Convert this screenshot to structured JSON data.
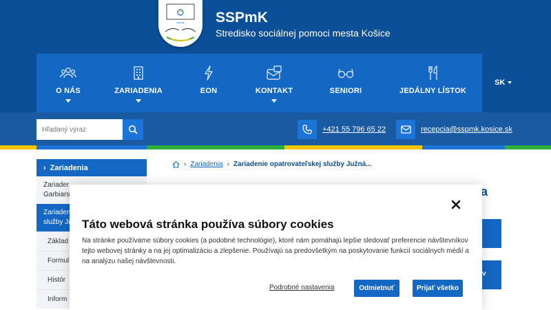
{
  "header": {
    "site_title": "SSPmK",
    "site_subtitle": "Stredisko sociálnej pomoci mesta Košice",
    "logo_alt": "Logo SSPmK"
  },
  "nav": {
    "items": [
      {
        "label": "O NÁS",
        "icon": "people-icon",
        "has_dropdown": true
      },
      {
        "label": "ZARIADENIA",
        "icon": "building-icon",
        "has_dropdown": true
      },
      {
        "label": "EON",
        "icon": "bolt-icon",
        "has_dropdown": false
      },
      {
        "label": "KONTAKT",
        "icon": "contact-card-icon",
        "has_dropdown": true
      },
      {
        "label": "SENIORI",
        "icon": "glasses-icon",
        "has_dropdown": false
      },
      {
        "label": "JEDÁLNY LÍSTOK",
        "icon": "cutlery-icon",
        "has_dropdown": false
      }
    ],
    "language": "SK"
  },
  "search": {
    "placeholder": "Hľadaný výraz"
  },
  "contacts": {
    "phone": "+421 55 796 65 22",
    "email": "recepcia@sspmk.kosice.sk"
  },
  "sidebar": {
    "heading": "Zariadenia",
    "items": [
      "Zariader",
      "Garbiars",
      "Zariaden",
      "služby Ju"
    ],
    "sub_items": [
      "Základ",
      "Formul",
      "Histór",
      "Inform"
    ]
  },
  "breadcrumb": {
    "section": "Zariadenia",
    "current": "Zariadenie opatrovateľskej služby Južná..."
  },
  "page_fragments": {
    "title_tail": "a",
    "button_tail": "v"
  },
  "cookie": {
    "title": "Táto webová stránka používa súbory cookies",
    "text": "Na stránke používame súbory cookies (a podobné technológie), ktoré nám pomáhajú lepšie sledovať preferencie návštevníkov tejto webovej stránky a na jej optimalizáciu a zlepšenie. Používajú sa predovšetkým na poskytovanie funkcií sociálnych médií a na analýzu našej návštevnosti.",
    "settings_link": "Podrobné nastavenia",
    "reject_label": "Odmietnuť",
    "accept_label": "Prijať všetko"
  },
  "colors": {
    "header_bg": "#0b4f99",
    "nav_bg": "#1468c4",
    "accent": "#1d74d8",
    "stripe": [
      "#f6c500",
      "#1d74d8",
      "#2eae3c",
      "#1d74d8",
      "#f6c500"
    ]
  }
}
